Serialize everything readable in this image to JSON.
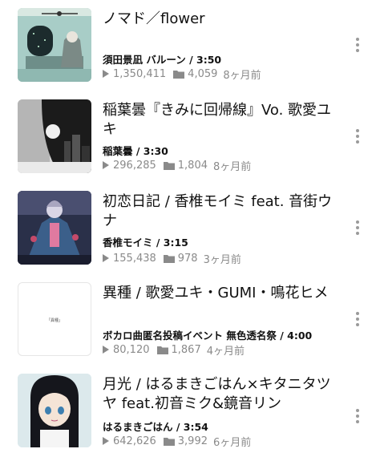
{
  "videos": [
    {
      "title": "ノマド／flower",
      "artist": "須田景凪 バルーン / 3:50",
      "views": "1,350,411",
      "mylists": "4,059",
      "ago": "8ヶ月前"
    },
    {
      "title": "稲葉曇『きみに回帰線』Vo. 歌愛ユキ",
      "artist": "稲葉曇 / 3:30",
      "views": "296,285",
      "mylists": "1,804",
      "ago": "8ヶ月前"
    },
    {
      "title": "初恋日記 / 香椎モイミ feat. 音街ウナ",
      "artist": "香椎モイミ / 3:15",
      "views": "155,438",
      "mylists": "978",
      "ago": "3ヶ月前"
    },
    {
      "title": "異種 / 歌愛ユキ・GUMI・鳴花ヒメ",
      "artist": "ボカロ曲匿名投稿イベント 無色透名祭 / 4:00",
      "views": "80,120",
      "mylists": "1,867",
      "ago": "4ヶ月前",
      "thumb_label": "「異種」"
    },
    {
      "title": "月光 / はるまきごはん×キタニタツヤ feat.初音ミク&鏡音リン",
      "artist": "はるまきごはん / 3:54",
      "views": "642,626",
      "mylists": "3,992",
      "ago": "6ヶ月前"
    }
  ]
}
